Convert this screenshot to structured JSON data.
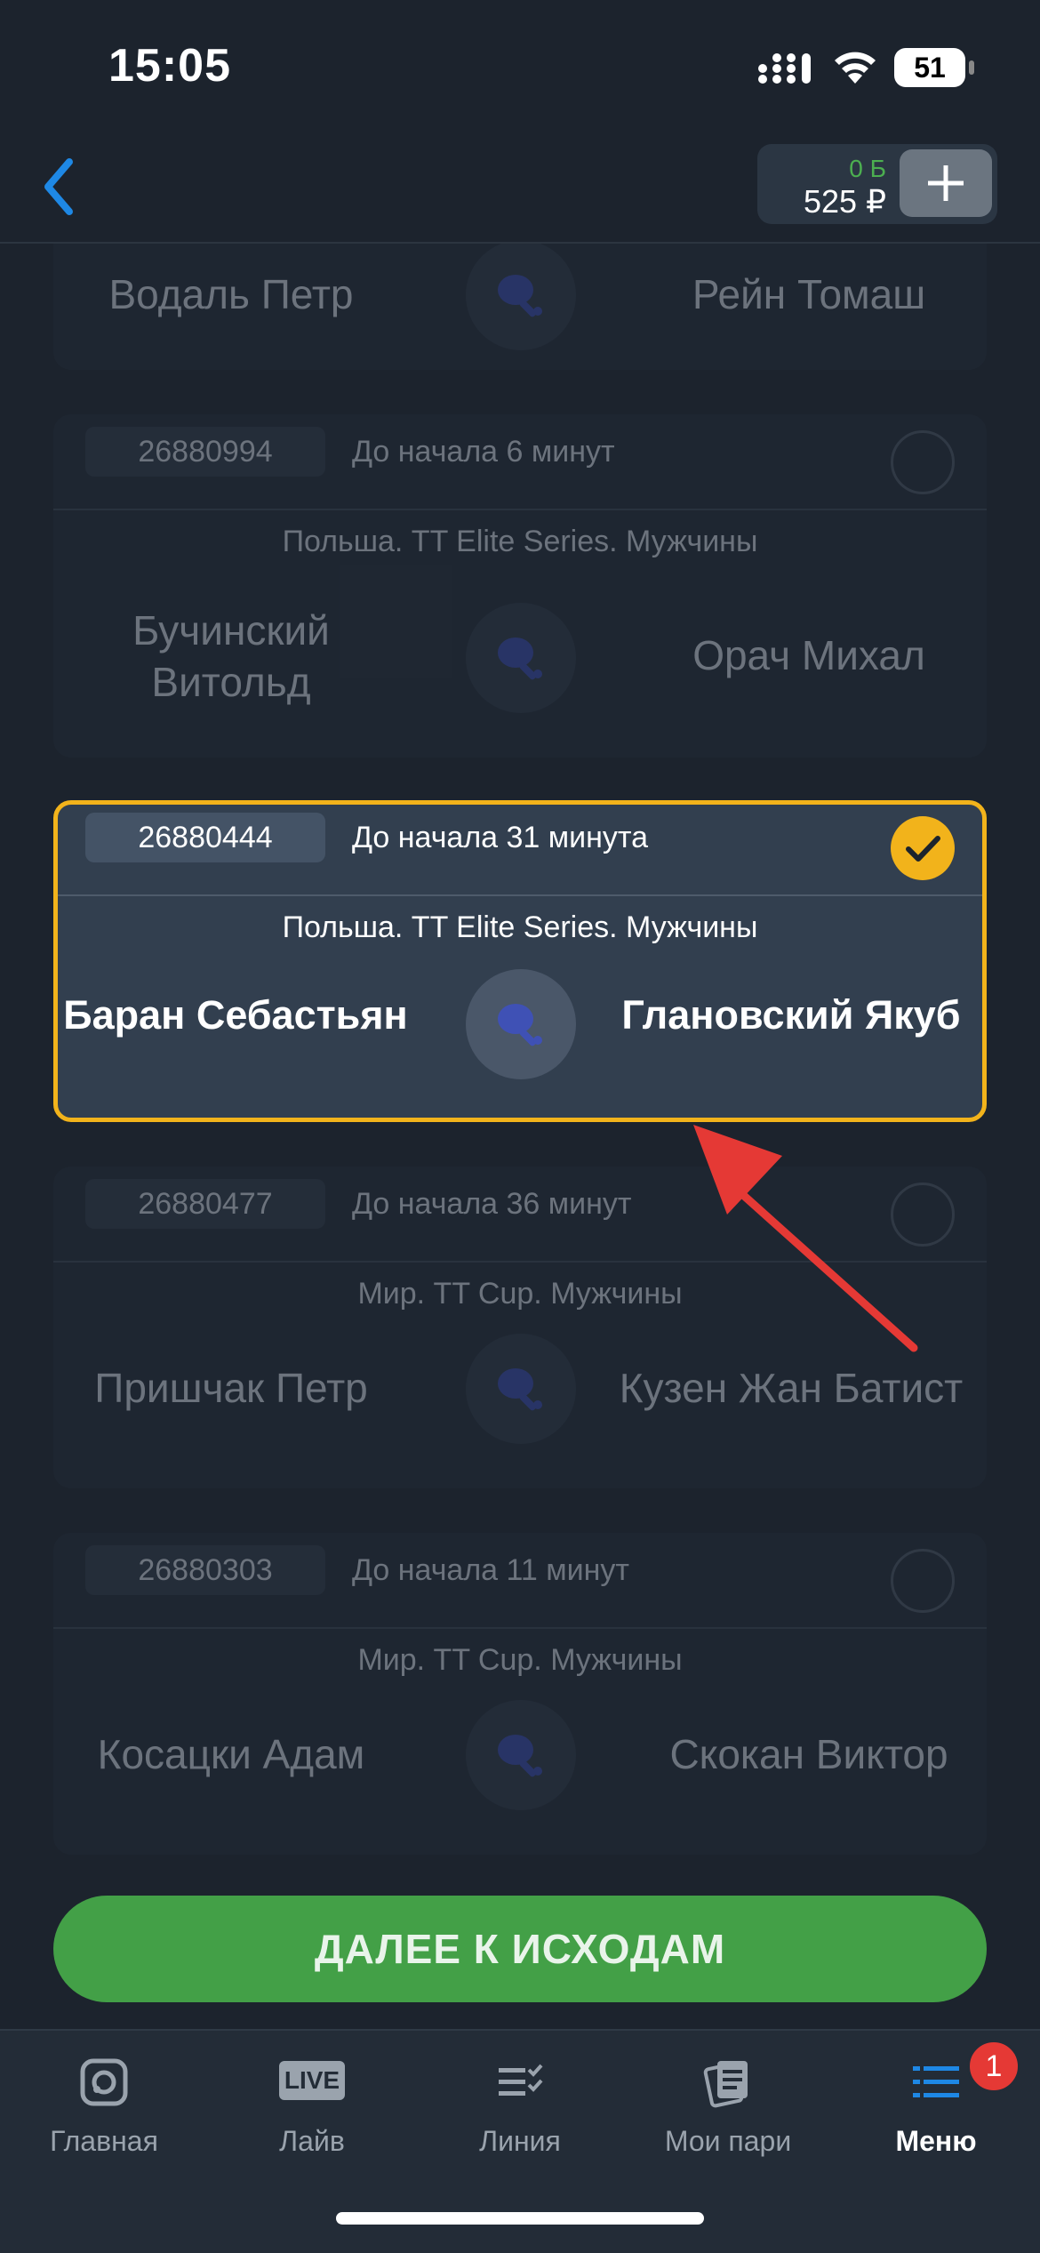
{
  "status": {
    "time": "15:05",
    "battery": "51"
  },
  "header": {
    "bonus": "0 Б",
    "balance": "525 ₽"
  },
  "matches": [
    {
      "id": "",
      "starts": "",
      "league": "",
      "left": "Водаль Петр",
      "right": "Рейн Томаш",
      "selected": false
    },
    {
      "id": "26880994",
      "starts": "До начала 6 минут",
      "league": "Польша. TT Elite Series. Мужчины",
      "left": "Бучинский Витольд",
      "right": "Орач Михал",
      "selected": false
    },
    {
      "id": "26880444",
      "starts": "До начала 31 минута",
      "league": "Польша. TT Elite Series. Мужчины",
      "left": "Баран Себастьян",
      "right": "Глановский Якуб",
      "selected": true
    },
    {
      "id": "26880477",
      "starts": "До начала 36 минут",
      "league": "Мир. TT Cup. Мужчины",
      "left": "Пришчак Петр",
      "right": "Кузен Жан Батист",
      "selected": false
    },
    {
      "id": "26880303",
      "starts": "До начала 11 минут",
      "league": "Мир. TT Cup. Мужчины",
      "left": "Косацки Адам",
      "right": "Скокан Виктор",
      "selected": false
    }
  ],
  "cta": {
    "label": "ДАЛЕЕ К ИСХОДАМ"
  },
  "tabs": [
    {
      "label": "Главная",
      "icon": "home-icon"
    },
    {
      "label": "Лайв",
      "icon": "live-icon",
      "icon_text": "LIVE"
    },
    {
      "label": "Линия",
      "icon": "line-list-icon"
    },
    {
      "label": "Мои пари",
      "icon": "my-bets-icon"
    },
    {
      "label": "Меню",
      "icon": "menu-icon",
      "badge": "1",
      "active": true
    }
  ],
  "colors": {
    "accent": "#f2b31b",
    "cta": "#43a047",
    "badge": "#e53935",
    "link": "#1e88e5"
  }
}
